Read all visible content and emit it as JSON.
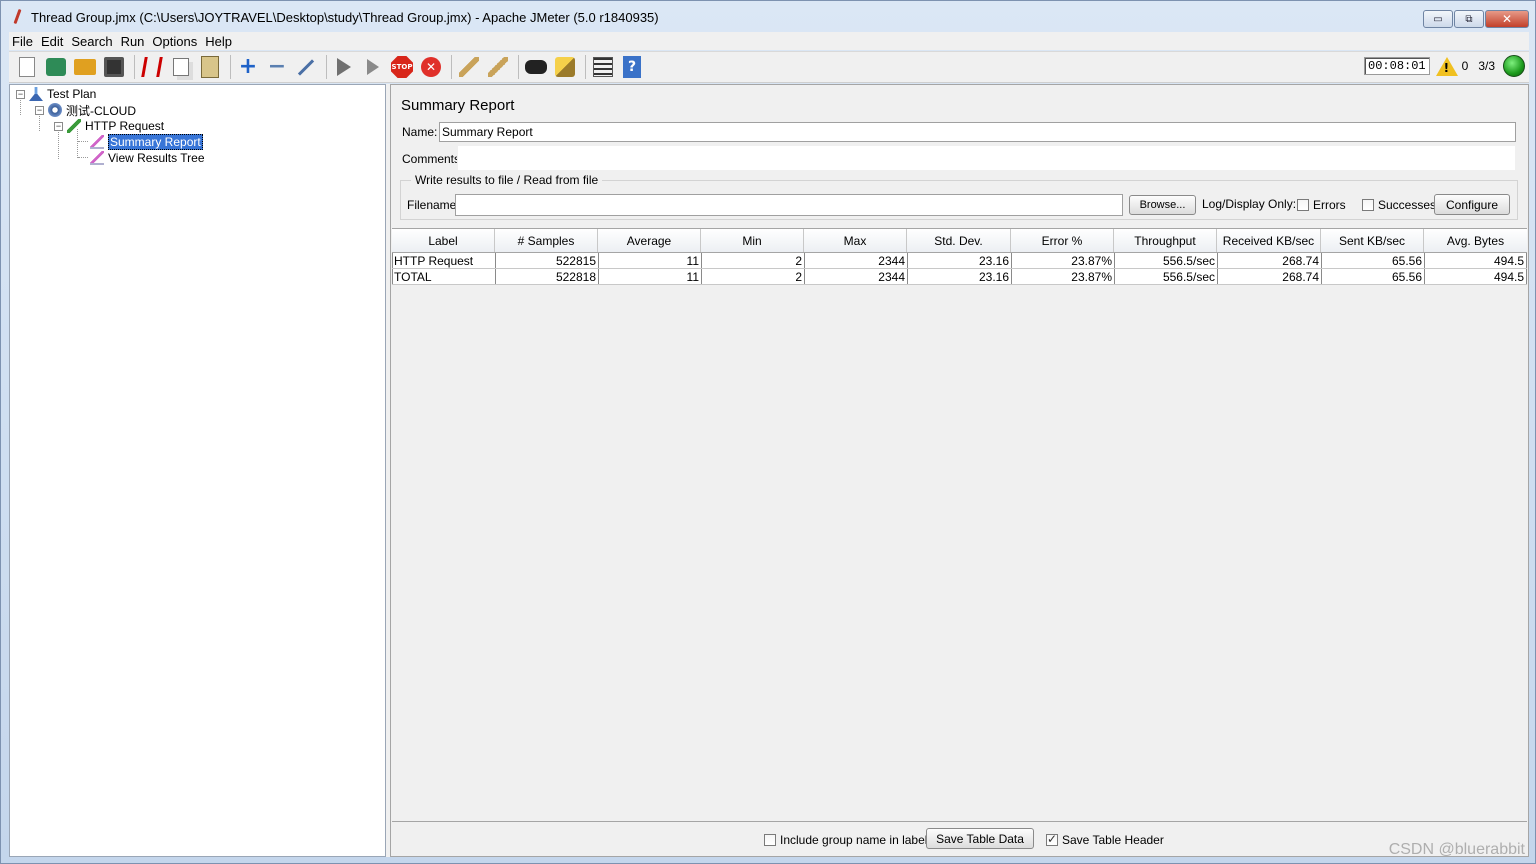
{
  "window": {
    "title": "Thread Group.jmx (C:\\Users\\JOYTRAVEL\\Desktop\\study\\Thread Group.jmx) - Apache JMeter (5.0 r1840935)",
    "minimize": "▭",
    "restore": "⧉",
    "close": "✕"
  },
  "menu": [
    "File",
    "Edit",
    "Search",
    "Run",
    "Options",
    "Help"
  ],
  "toolbar": {
    "buttons": [
      "new-icon",
      "templates-icon",
      "open-icon",
      "save-icon",
      "cut-icon",
      "copy-icon",
      "paste-icon",
      "expand-icon",
      "collapse-icon",
      "toggle-icon",
      "start-icon",
      "start-no-pauses-icon",
      "stop-icon",
      "shutdown-icon",
      "clear-icon",
      "clear-all-icon",
      "search-icon",
      "reset-search-icon",
      "function-helper-icon",
      "help-icon"
    ],
    "timer": "00:08:01",
    "warning_count": "0",
    "threads": "3/3"
  },
  "tree": {
    "items": [
      {
        "label": "Test Plan",
        "expander": "−"
      },
      {
        "label": "测试-CLOUD",
        "expander": "−"
      },
      {
        "label": "HTTP Request",
        "expander": "−"
      },
      {
        "label": "Summary Report"
      },
      {
        "label": "View Results Tree"
      }
    ]
  },
  "panel": {
    "title": "Summary Report",
    "name_label": "Name:",
    "name_value": "Summary Report",
    "comments_label": "Comments:",
    "file_group_title": "Write results to file / Read from file",
    "filename_label": "Filename",
    "filename_value": "",
    "browse_label": "Browse...",
    "log_display_label": "Log/Display Only:",
    "errors_label": "Errors",
    "successes_label": "Successes",
    "configure_label": "Configure"
  },
  "table": {
    "columns": [
      "Label",
      "# Samples",
      "Average",
      "Min",
      "Max",
      "Std. Dev.",
      "Error %",
      "Throughput",
      "Received KB/sec",
      "Sent KB/sec",
      "Avg. Bytes"
    ],
    "rows": [
      [
        "HTTP Request",
        "522815",
        "11",
        "2",
        "2344",
        "23.16",
        "23.87%",
        "556.5/sec",
        "268.74",
        "65.56",
        "494.5"
      ],
      [
        "TOTAL",
        "522818",
        "11",
        "2",
        "2344",
        "23.16",
        "23.87%",
        "556.5/sec",
        "268.74",
        "65.56",
        "494.5"
      ]
    ]
  },
  "bottom": {
    "include_group_label": "Include group name in label?",
    "include_group_checked": false,
    "save_table_data_label": "Save Table Data",
    "save_table_header_label": "Save Table Header",
    "save_table_header_checked": true
  },
  "watermark": "CSDN @bluerabbit"
}
